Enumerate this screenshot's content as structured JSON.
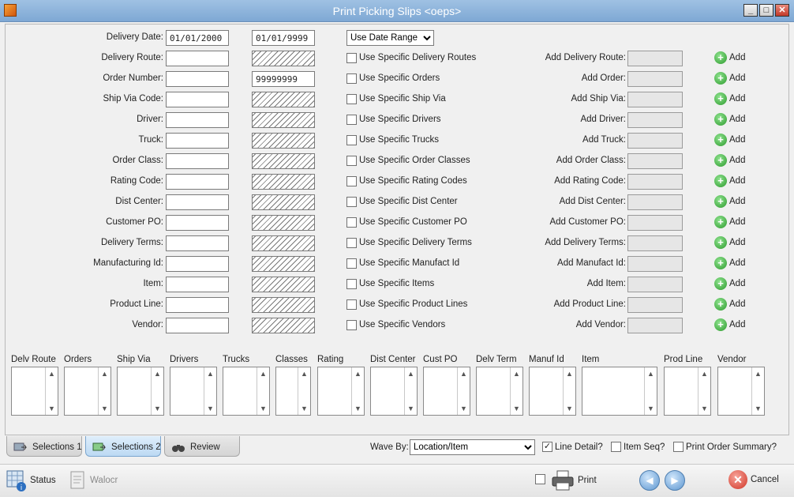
{
  "window": {
    "title": "Print Picking Slips <oeps>"
  },
  "delivery_date": {
    "label": "Delivery Date:",
    "from": "01/01/2000",
    "to": "01/01/9999",
    "mode": "Use Date Range"
  },
  "rows": [
    {
      "label": "Delivery Route:",
      "from": "",
      "to": "",
      "to_hatched": true,
      "check": "Use Specific Delivery Routes",
      "add_label": "Add Delivery Route:"
    },
    {
      "label": "Order Number:",
      "from": "",
      "to": "99999999",
      "to_hatched": false,
      "check": "Use Specific Orders",
      "add_label": "Add Order:"
    },
    {
      "label": "Ship Via Code:",
      "from": "",
      "to": "",
      "to_hatched": true,
      "check": "Use Specific Ship Via",
      "add_label": "Add Ship Via:"
    },
    {
      "label": "Driver:",
      "from": "",
      "to": "",
      "to_hatched": true,
      "check": "Use Specific Drivers",
      "add_label": "Add Driver:"
    },
    {
      "label": "Truck:",
      "from": "",
      "to": "",
      "to_hatched": true,
      "check": "Use Specific Trucks",
      "add_label": "Add Truck:"
    },
    {
      "label": "Order Class:",
      "from": "",
      "to": "",
      "to_hatched": true,
      "check": "Use Specific Order Classes",
      "add_label": "Add Order Class:"
    },
    {
      "label": "Rating Code:",
      "from": "",
      "to": "",
      "to_hatched": true,
      "check": "Use Specific Rating Codes",
      "add_label": "Add Rating Code:"
    },
    {
      "label": "Dist Center:",
      "from": "",
      "to": "",
      "to_hatched": true,
      "check": "Use Specific Dist Center",
      "add_label": "Add Dist Center:"
    },
    {
      "label": "Customer PO:",
      "from": "",
      "to": "",
      "to_hatched": true,
      "check": "Use Specific Customer PO",
      "add_label": "Add Customer PO:"
    },
    {
      "label": "Delivery Terms:",
      "from": "",
      "to": "",
      "to_hatched": true,
      "check": "Use Specific Delivery Terms",
      "add_label": "Add Delivery Terms:"
    },
    {
      "label": "Manufacturing Id:",
      "from": "",
      "to": "",
      "to_hatched": true,
      "check": "Use Specific Manufact Id",
      "add_label": "Add Manufact Id:"
    },
    {
      "label": "Item:",
      "from": "",
      "to": "",
      "to_hatched": true,
      "check": "Use Specific Items",
      "add_label": "Add Item:"
    },
    {
      "label": "Product Line:",
      "from": "",
      "to": "",
      "to_hatched": true,
      "check": "Use Specific Product Lines",
      "add_label": "Add Product Line:"
    },
    {
      "label": "Vendor:",
      "from": "",
      "to": "",
      "to_hatched": true,
      "check": "Use Specific Vendors",
      "add_label": "Add Vendor:"
    }
  ],
  "add_button_label": "Add",
  "list_boxes": [
    "Delv Route",
    "Orders",
    "Ship Via",
    "Drivers",
    "Trucks",
    "Classes",
    "Rating",
    "Dist Center",
    "Cust PO",
    "Delv Term",
    "Manuf Id",
    "Item",
    "Prod Line",
    "Vendor"
  ],
  "tabs": [
    {
      "label": "Selections 1",
      "active": false
    },
    {
      "label": "Selections 2",
      "active": true
    },
    {
      "label": "Review",
      "active": false
    }
  ],
  "wave_by": {
    "label": "Wave By:",
    "value": "Location/Item"
  },
  "options": [
    {
      "label": "Line Detail?",
      "checked": true
    },
    {
      "label": "Item Seq?",
      "checked": false
    },
    {
      "label": "Print Order Summary?",
      "checked": false
    }
  ],
  "toolbar": {
    "status": "Status",
    "walocr": "Walocr",
    "print": "Print",
    "cancel": "Cancel",
    "print_checked": false
  },
  "icons": {
    "plus": "plus-circle-icon",
    "back": "arrow-left-icon",
    "forward": "arrow-right-icon",
    "cancel": "x-circle-icon",
    "print": "printer-icon"
  },
  "colors": {
    "titlebar": "#8cb3dc",
    "active_tab": "#bcd9f3",
    "add_green": "#2d9a2d",
    "cancel_red": "#cf3324"
  }
}
